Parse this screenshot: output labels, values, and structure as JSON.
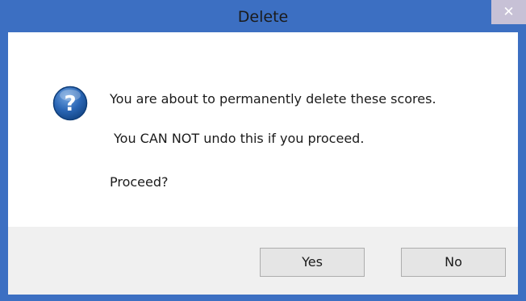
{
  "window": {
    "title": "Delete",
    "close_glyph": "✕"
  },
  "dialog": {
    "icon": "question-icon",
    "icon_glyph": "?",
    "message_line1": "You are about to permanently delete these scores.",
    "message_line2": "You CAN NOT undo this if you proceed.",
    "message_line3": "Proceed?"
  },
  "buttons": {
    "yes_label": "Yes",
    "no_label": "No"
  },
  "colors": {
    "titlebar": "#3c6fc2",
    "close_button": "#c7c1d6",
    "content_bg": "#ffffff",
    "footer_bg": "#f0f0f0",
    "icon_blue": "#1d5ca8"
  }
}
